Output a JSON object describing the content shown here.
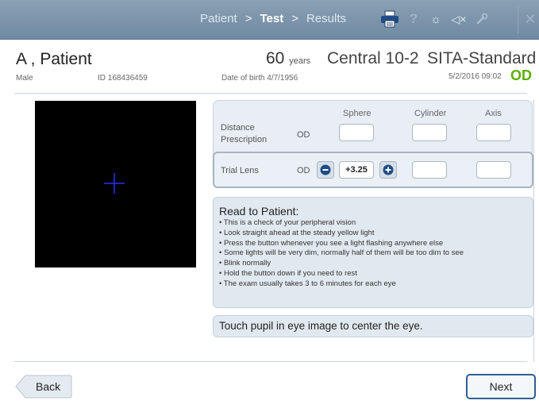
{
  "nav": {
    "step_patient": "Patient",
    "step_test": "Test",
    "step_results": "Results",
    "separator": ">"
  },
  "toolbar": {
    "icons": [
      "printer-icon",
      "help-icon",
      "brightness-icon",
      "mute-icon",
      "wrench-icon",
      "close-icon"
    ],
    "help_glyph": "?",
    "brightness_glyph": "☼",
    "mute_glyph": "◁×",
    "close_glyph": "✕"
  },
  "patient": {
    "name": "A , Patient",
    "sex": "Male",
    "id": "ID 168436459",
    "age": "60",
    "age_unit": "years",
    "dob": "Date of birth  4/7/1956"
  },
  "test": {
    "pattern": "Central 10-2",
    "strategy": "SITA-Standard",
    "date": "5/2/2016 09:02",
    "eye": "OD",
    "eye_color": "#5cb000"
  },
  "prescription": {
    "headers": {
      "sphere": "Sphere",
      "cylinder": "Cylinder",
      "axis": "Axis"
    },
    "distance_label": "Distance Prescription",
    "distance_eye": "OD",
    "distance_sphere": "",
    "distance_cylinder": "",
    "distance_axis": "",
    "trial_label": "Trial Lens",
    "trial_eye": "OD",
    "trial_sphere": "+3.25",
    "trial_cylinder": "",
    "trial_axis": ""
  },
  "instructions": {
    "title": "Read to Patient:",
    "items": [
      "This is a check of your peripheral vision",
      "Look straight ahead at the steady yellow light",
      "Press the button whenever you see a light flashing anywhere else",
      "Some lights will be very dim, normally half of them will be too dim to see",
      "Blink normally",
      "Hold the button down if you need to rest",
      "The exam usually takes 3 to 6 minutes for each eye"
    ]
  },
  "hint": "Touch pupil in eye image to center the eye.",
  "footer": {
    "back": "Back",
    "next": "Next"
  },
  "colors": {
    "topbar": "#7a93aa",
    "accent_button": "#2f5f93",
    "crosshair": "#2233ff"
  }
}
